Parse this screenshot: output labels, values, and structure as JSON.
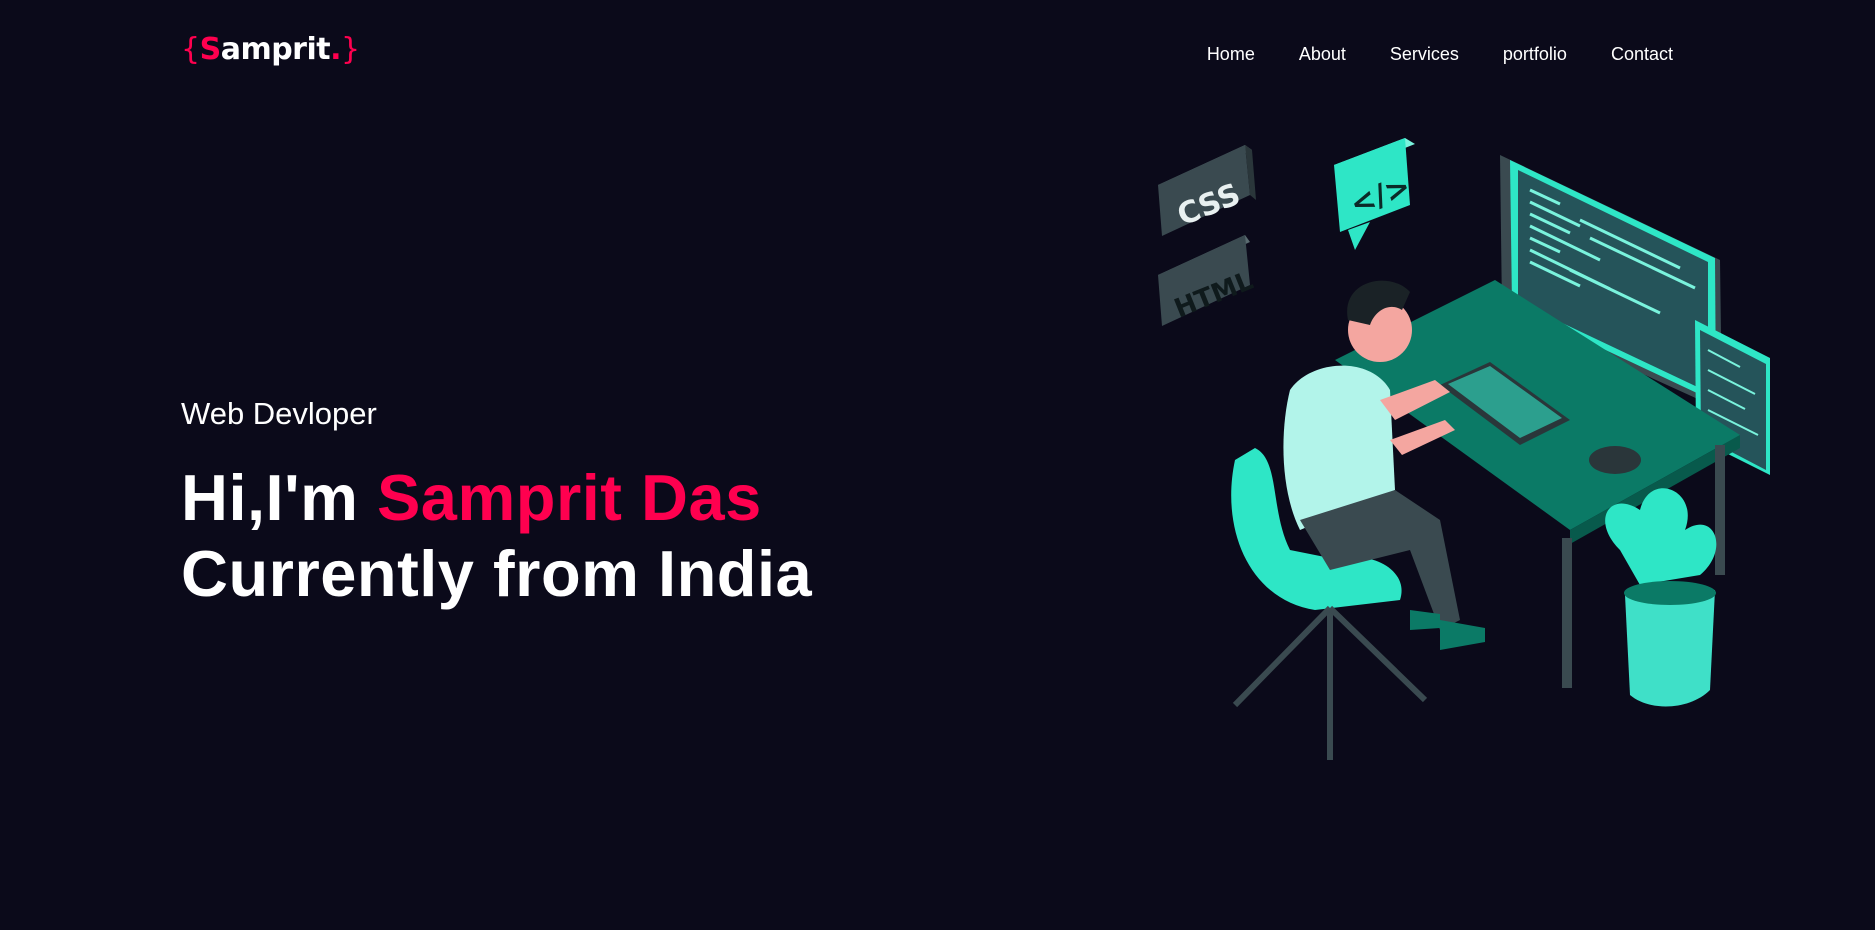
{
  "logo": {
    "open": "{",
    "initial": "S",
    "rest": "amprit",
    "dot": ".",
    "close": "}"
  },
  "nav": {
    "items": [
      "Home",
      "About",
      "Services",
      "portfolio",
      "Contact"
    ]
  },
  "hero": {
    "subtitle": "Web Devloper",
    "greeting": "Hi,I'm ",
    "name": "Samprit Das",
    "line2": "Currently from India"
  },
  "illustration": {
    "css_tag": "CSS",
    "html_tag": "HTML",
    "code_bubble": "</>"
  },
  "colors": {
    "background": "#0b0a1a",
    "accent": "#ff004f",
    "teal": "#2ee6c6",
    "dark_teal": "#0b7a66"
  }
}
